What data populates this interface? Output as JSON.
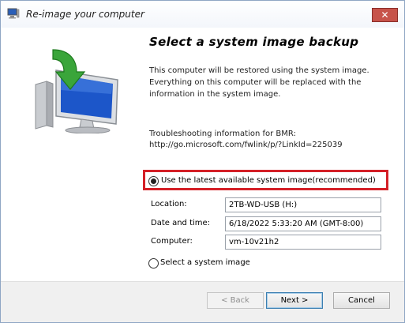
{
  "window": {
    "title": "Re-image your computer",
    "close_label": "✕"
  },
  "main": {
    "heading": "Select a system image backup",
    "description": "This computer will be restored using the system image. Everything on this computer will be replaced with the information in the system image.",
    "bmr_line1": "Troubleshooting information for BMR:",
    "bmr_line2": "http://go.microsoft.com/fwlink/p/?LinkId=225039"
  },
  "options": {
    "latest_label": "Use the latest available system image(recommended)",
    "latest_selected": true,
    "select_label": "Select a system image",
    "select_selected": false
  },
  "fields": {
    "location_label": "Location:",
    "location_value": "2TB-WD-USB (H:)",
    "datetime_label": "Date and time:",
    "datetime_value": "6/18/2022 5:33:20 AM (GMT-8:00)",
    "computer_label": "Computer:",
    "computer_value": "vm-10v21h2"
  },
  "buttons": {
    "back_label": "< Back",
    "next_label": "Next >",
    "cancel_label": "Cancel"
  },
  "colors": {
    "highlight": "#d42027",
    "arrow_green": "#3aa53a",
    "screen_blue": "#1c56c9"
  }
}
